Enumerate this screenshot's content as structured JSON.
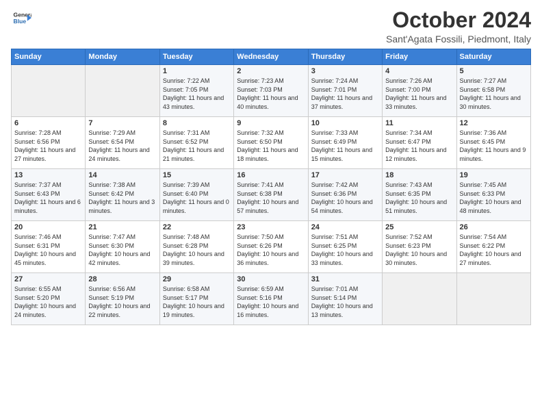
{
  "logo": {
    "line1": "General",
    "line2": "Blue",
    "icon": "▶"
  },
  "header": {
    "month_title": "October 2024",
    "location": "Sant'Agata Fossili, Piedmont, Italy"
  },
  "days_of_week": [
    "Sunday",
    "Monday",
    "Tuesday",
    "Wednesday",
    "Thursday",
    "Friday",
    "Saturday"
  ],
  "weeks": [
    [
      {
        "day": "",
        "sunrise": "",
        "sunset": "",
        "daylight": ""
      },
      {
        "day": "",
        "sunrise": "",
        "sunset": "",
        "daylight": ""
      },
      {
        "day": "1",
        "sunrise": "Sunrise: 7:22 AM",
        "sunset": "Sunset: 7:05 PM",
        "daylight": "Daylight: 11 hours and 43 minutes."
      },
      {
        "day": "2",
        "sunrise": "Sunrise: 7:23 AM",
        "sunset": "Sunset: 7:03 PM",
        "daylight": "Daylight: 11 hours and 40 minutes."
      },
      {
        "day": "3",
        "sunrise": "Sunrise: 7:24 AM",
        "sunset": "Sunset: 7:01 PM",
        "daylight": "Daylight: 11 hours and 37 minutes."
      },
      {
        "day": "4",
        "sunrise": "Sunrise: 7:26 AM",
        "sunset": "Sunset: 7:00 PM",
        "daylight": "Daylight: 11 hours and 33 minutes."
      },
      {
        "day": "5",
        "sunrise": "Sunrise: 7:27 AM",
        "sunset": "Sunset: 6:58 PM",
        "daylight": "Daylight: 11 hours and 30 minutes."
      }
    ],
    [
      {
        "day": "6",
        "sunrise": "Sunrise: 7:28 AM",
        "sunset": "Sunset: 6:56 PM",
        "daylight": "Daylight: 11 hours and 27 minutes."
      },
      {
        "day": "7",
        "sunrise": "Sunrise: 7:29 AM",
        "sunset": "Sunset: 6:54 PM",
        "daylight": "Daylight: 11 hours and 24 minutes."
      },
      {
        "day": "8",
        "sunrise": "Sunrise: 7:31 AM",
        "sunset": "Sunset: 6:52 PM",
        "daylight": "Daylight: 11 hours and 21 minutes."
      },
      {
        "day": "9",
        "sunrise": "Sunrise: 7:32 AM",
        "sunset": "Sunset: 6:50 PM",
        "daylight": "Daylight: 11 hours and 18 minutes."
      },
      {
        "day": "10",
        "sunrise": "Sunrise: 7:33 AM",
        "sunset": "Sunset: 6:49 PM",
        "daylight": "Daylight: 11 hours and 15 minutes."
      },
      {
        "day": "11",
        "sunrise": "Sunrise: 7:34 AM",
        "sunset": "Sunset: 6:47 PM",
        "daylight": "Daylight: 11 hours and 12 minutes."
      },
      {
        "day": "12",
        "sunrise": "Sunrise: 7:36 AM",
        "sunset": "Sunset: 6:45 PM",
        "daylight": "Daylight: 11 hours and 9 minutes."
      }
    ],
    [
      {
        "day": "13",
        "sunrise": "Sunrise: 7:37 AM",
        "sunset": "Sunset: 6:43 PM",
        "daylight": "Daylight: 11 hours and 6 minutes."
      },
      {
        "day": "14",
        "sunrise": "Sunrise: 7:38 AM",
        "sunset": "Sunset: 6:42 PM",
        "daylight": "Daylight: 11 hours and 3 minutes."
      },
      {
        "day": "15",
        "sunrise": "Sunrise: 7:39 AM",
        "sunset": "Sunset: 6:40 PM",
        "daylight": "Daylight: 11 hours and 0 minutes."
      },
      {
        "day": "16",
        "sunrise": "Sunrise: 7:41 AM",
        "sunset": "Sunset: 6:38 PM",
        "daylight": "Daylight: 10 hours and 57 minutes."
      },
      {
        "day": "17",
        "sunrise": "Sunrise: 7:42 AM",
        "sunset": "Sunset: 6:36 PM",
        "daylight": "Daylight: 10 hours and 54 minutes."
      },
      {
        "day": "18",
        "sunrise": "Sunrise: 7:43 AM",
        "sunset": "Sunset: 6:35 PM",
        "daylight": "Daylight: 10 hours and 51 minutes."
      },
      {
        "day": "19",
        "sunrise": "Sunrise: 7:45 AM",
        "sunset": "Sunset: 6:33 PM",
        "daylight": "Daylight: 10 hours and 48 minutes."
      }
    ],
    [
      {
        "day": "20",
        "sunrise": "Sunrise: 7:46 AM",
        "sunset": "Sunset: 6:31 PM",
        "daylight": "Daylight: 10 hours and 45 minutes."
      },
      {
        "day": "21",
        "sunrise": "Sunrise: 7:47 AM",
        "sunset": "Sunset: 6:30 PM",
        "daylight": "Daylight: 10 hours and 42 minutes."
      },
      {
        "day": "22",
        "sunrise": "Sunrise: 7:48 AM",
        "sunset": "Sunset: 6:28 PM",
        "daylight": "Daylight: 10 hours and 39 minutes."
      },
      {
        "day": "23",
        "sunrise": "Sunrise: 7:50 AM",
        "sunset": "Sunset: 6:26 PM",
        "daylight": "Daylight: 10 hours and 36 minutes."
      },
      {
        "day": "24",
        "sunrise": "Sunrise: 7:51 AM",
        "sunset": "Sunset: 6:25 PM",
        "daylight": "Daylight: 10 hours and 33 minutes."
      },
      {
        "day": "25",
        "sunrise": "Sunrise: 7:52 AM",
        "sunset": "Sunset: 6:23 PM",
        "daylight": "Daylight: 10 hours and 30 minutes."
      },
      {
        "day": "26",
        "sunrise": "Sunrise: 7:54 AM",
        "sunset": "Sunset: 6:22 PM",
        "daylight": "Daylight: 10 hours and 27 minutes."
      }
    ],
    [
      {
        "day": "27",
        "sunrise": "Sunrise: 6:55 AM",
        "sunset": "Sunset: 5:20 PM",
        "daylight": "Daylight: 10 hours and 24 minutes."
      },
      {
        "day": "28",
        "sunrise": "Sunrise: 6:56 AM",
        "sunset": "Sunset: 5:19 PM",
        "daylight": "Daylight: 10 hours and 22 minutes."
      },
      {
        "day": "29",
        "sunrise": "Sunrise: 6:58 AM",
        "sunset": "Sunset: 5:17 PM",
        "daylight": "Daylight: 10 hours and 19 minutes."
      },
      {
        "day": "30",
        "sunrise": "Sunrise: 6:59 AM",
        "sunset": "Sunset: 5:16 PM",
        "daylight": "Daylight: 10 hours and 16 minutes."
      },
      {
        "day": "31",
        "sunrise": "Sunrise: 7:01 AM",
        "sunset": "Sunset: 5:14 PM",
        "daylight": "Daylight: 10 hours and 13 minutes."
      },
      {
        "day": "",
        "sunrise": "",
        "sunset": "",
        "daylight": ""
      },
      {
        "day": "",
        "sunrise": "",
        "sunset": "",
        "daylight": ""
      }
    ]
  ]
}
